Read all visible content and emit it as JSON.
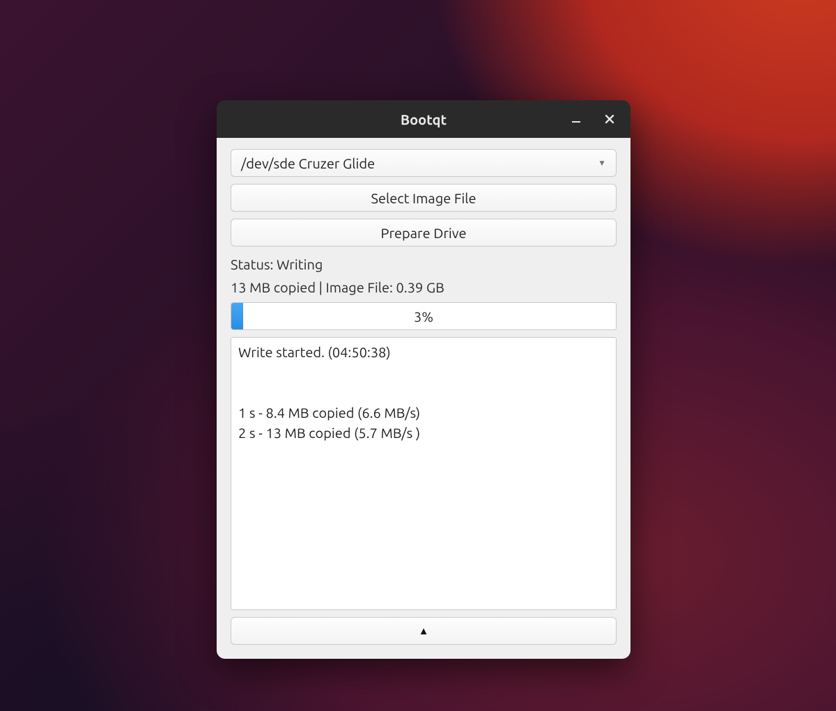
{
  "window": {
    "title": "Bootqt"
  },
  "drive_selector": {
    "selected": "/dev/sde     Cruzer Glide"
  },
  "buttons": {
    "select_image": "Select Image File",
    "prepare_drive": "Prepare Drive"
  },
  "status": {
    "label": "Status: Writing",
    "detail": "13 MB copied | Image File: 0.39 GB"
  },
  "progress": {
    "percent": 3,
    "text": "3%"
  },
  "log": "Write started. (04:50:38)\n\n\n1 s - 8.4 MB copied (6.6 MB/s)\n2 s - 13 MB copied (5.7 MB/s )",
  "expander": {
    "glyph": "▲"
  }
}
